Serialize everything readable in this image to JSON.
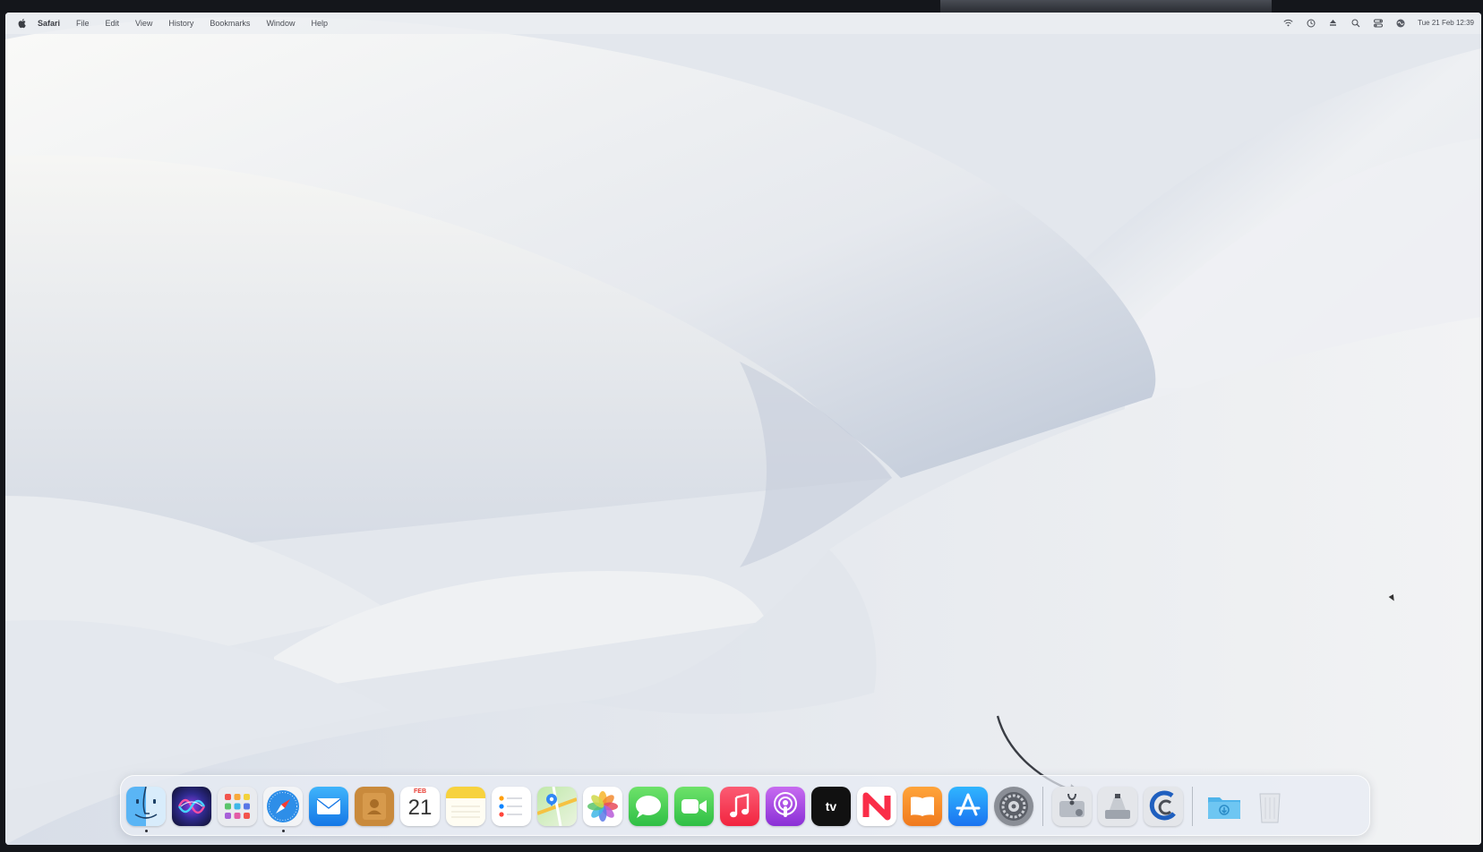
{
  "menubar": {
    "apple_icon": "apple-icon",
    "active_app": "Safari",
    "menus": [
      "File",
      "Edit",
      "View",
      "History",
      "Bookmarks",
      "Window",
      "Help"
    ],
    "status_icons": [
      "wifi-icon",
      "time-machine-icon",
      "eject-icon",
      "spotlight-icon",
      "control-center-icon",
      "siri-icon"
    ],
    "clock": "Tue 21 Feb 12:39"
  },
  "dock": {
    "apps": [
      {
        "name": "Finder",
        "icon": "finder-icon",
        "running": true
      },
      {
        "name": "Siri",
        "icon": "siri-icon",
        "running": false
      },
      {
        "name": "Launchpad",
        "icon": "launchpad-icon",
        "running": false
      },
      {
        "name": "Safari",
        "icon": "safari-icon",
        "running": true
      },
      {
        "name": "Mail",
        "icon": "mail-icon",
        "running": false
      },
      {
        "name": "Contacts",
        "icon": "contacts-icon",
        "running": false
      },
      {
        "name": "Calendar",
        "icon": "calendar-icon",
        "running": false
      },
      {
        "name": "Notes",
        "icon": "notes-icon",
        "running": false
      },
      {
        "name": "Reminders",
        "icon": "reminders-icon",
        "running": false
      },
      {
        "name": "Maps",
        "icon": "maps-icon",
        "running": false
      },
      {
        "name": "Photos",
        "icon": "photos-icon",
        "running": false
      },
      {
        "name": "Messages",
        "icon": "messages-icon",
        "running": false
      },
      {
        "name": "FaceTime",
        "icon": "facetime-icon",
        "running": false
      },
      {
        "name": "Music",
        "icon": "music-icon",
        "running": false
      },
      {
        "name": "Podcasts",
        "icon": "podcasts-icon",
        "running": false
      },
      {
        "name": "TV",
        "icon": "apple-tv-icon",
        "running": false
      },
      {
        "name": "News",
        "icon": "news-icon",
        "running": false
      },
      {
        "name": "Books",
        "icon": "books-icon",
        "running": false
      },
      {
        "name": "App Store",
        "icon": "app-store-icon",
        "running": false
      },
      {
        "name": "System Preferences",
        "icon": "system-preferences-icon",
        "running": false
      }
    ],
    "utilities": [
      {
        "name": "Disk Utility",
        "icon": "disk-utility-icon"
      },
      {
        "name": "Boot Camp Assistant",
        "icon": "boot-camp-icon"
      },
      {
        "name": "Migration Assistant",
        "icon": "migration-icon"
      }
    ],
    "stack": {
      "name": "Downloads",
      "icon": "downloads-folder-icon"
    },
    "trash": {
      "name": "Trash",
      "icon": "trash-icon"
    },
    "calendar_month": "FEB",
    "calendar_day": "21",
    "tv_label": "tv"
  },
  "annotation": {
    "icon": "arrow-pointer-icon",
    "target": "System Preferences"
  },
  "colors": {
    "menubar_bg": "#eceef2",
    "dock_bg": "#e8ecf4",
    "snow_light": "#f4f4f2",
    "snow_shadow": "#b8c3d5"
  }
}
